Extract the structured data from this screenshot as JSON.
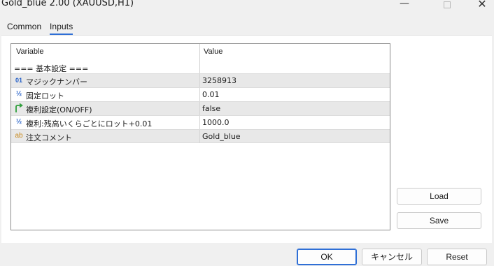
{
  "window": {
    "title": "Gold_blue 2.00 (XAUUSD,H1)",
    "minimize_glyph": "—",
    "close_glyph": "✕"
  },
  "tabs": [
    {
      "label": "Common",
      "active": false
    },
    {
      "label": "Inputs",
      "active": true
    }
  ],
  "grid": {
    "headers": {
      "variable": "Variable",
      "value": "Value"
    },
    "group_label": "=== 基本設定 ===",
    "rows": [
      {
        "icon": "int-icon",
        "icon_glyph": "01",
        "name": "マジックナンバー",
        "value": "3258913"
      },
      {
        "icon": "double-icon",
        "icon_glyph": "½",
        "name": "固定ロット",
        "value": "0.01"
      },
      {
        "icon": "bool-icon",
        "icon_glyph": "",
        "name": "複利設定(ON/OFF)",
        "value": "false"
      },
      {
        "icon": "double-icon",
        "icon_glyph": "½",
        "name": "複利:残高いくらごとにロット+0.01",
        "value": "1000.0"
      },
      {
        "icon": "string-icon",
        "icon_glyph": "ab",
        "name": "注文コメント",
        "value": "Gold_blue"
      }
    ]
  },
  "buttons": {
    "load": "Load",
    "save": "Save",
    "ok": "OK",
    "cancel": "キャンセル",
    "reset": "Reset"
  },
  "colors": {
    "accent": "#2f6fd6",
    "row_shade": "#e8e8e8",
    "icon_blue": "#2560c8",
    "icon_orange": "#c88a1e",
    "bool_icon_green": "#2e9e3a"
  }
}
